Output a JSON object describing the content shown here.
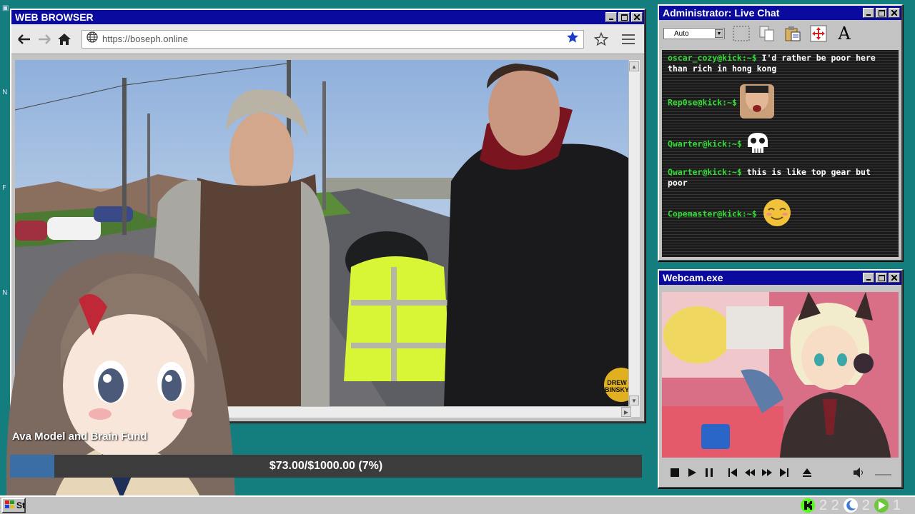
{
  "browser": {
    "title": "WEB BROWSER",
    "url": "https://boseph.online"
  },
  "chat": {
    "title": "Administrator: Live Chat",
    "font_size_select": "Auto",
    "messages": [
      {
        "user": "oscar_cozy@kick:~$",
        "text": "I'd rather be poor here than rich in hong kong"
      },
      {
        "user": "Rep0se@kick:~$",
        "text": "",
        "emote": "face-emote"
      },
      {
        "user": "Qwarter@kick:~$",
        "text": "",
        "emote": "skull-emote"
      },
      {
        "user": "Qwarter@kick:~$",
        "text": "this is like top gear but poor"
      },
      {
        "user": "Copemaster@kick:~$",
        "text": "",
        "emote": "smile-emote"
      }
    ]
  },
  "webcam": {
    "title": "Webcam.exe"
  },
  "fund": {
    "label": "Ava Model and Brain Fund",
    "amount_text": "$73.00/$1000.00 (7%)",
    "progress": 0.07
  },
  "video": {
    "watermark": "DREW BINSKY"
  },
  "taskbar": {
    "start_label": "St",
    "tray": [
      {
        "icon": "kick-icon",
        "value": "2 2"
      },
      {
        "icon": "moon-icon",
        "value": "2"
      },
      {
        "icon": "play-circle-icon",
        "value": "1"
      }
    ]
  },
  "colors": {
    "desktop": "#147d7d",
    "titlebar": "#0a0a9e",
    "chat_username": "#33dd33",
    "progress_fill": "#3a6ea5"
  }
}
